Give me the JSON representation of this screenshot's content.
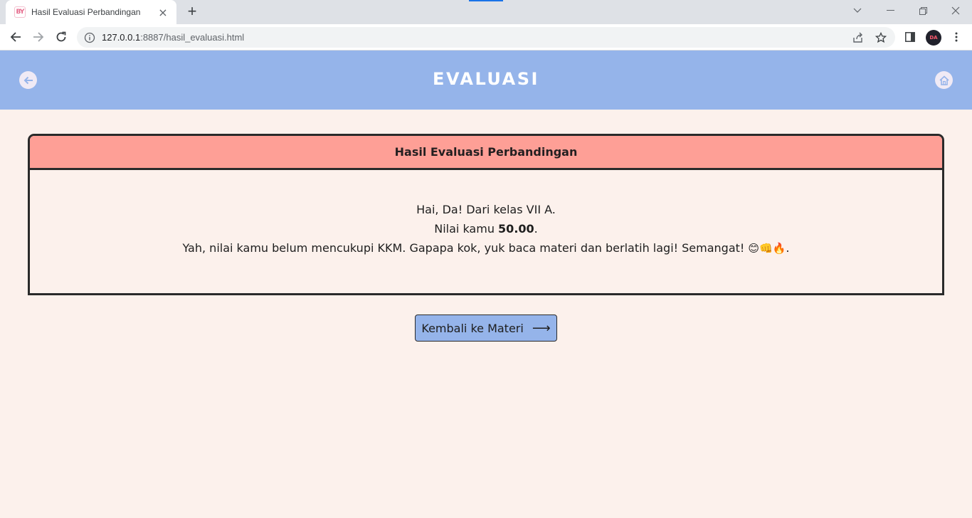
{
  "browser": {
    "tab_title": "Hasil Evaluasi Perbandingan",
    "favicon_text": "BY",
    "url_host": "127.0.0.1",
    "url_rest": ":8887/hasil_evaluasi.html",
    "profile_initials": "DA"
  },
  "header": {
    "title": "EVALUASI"
  },
  "card": {
    "title": "Hasil Evaluasi Perbandingan",
    "greeting": "Hai, Da! Dari kelas VII A.",
    "score_prefix": "Nilai kamu ",
    "score_value": "50.00",
    "score_suffix": ".",
    "message": "Yah, nilai kamu belum mencukupi KKM. Gapapa kok, yuk baca materi dan berlatih lagi! Semangat! ",
    "emojis": "😊👊🔥",
    "message_end": "."
  },
  "back_button": {
    "label": "Kembali ke Materi",
    "arrow": "⟶"
  },
  "colors": {
    "header_bg": "#95b4ea",
    "page_bg": "#fcf1ec",
    "card_head_bg": "#fe9f96",
    "border": "#2a2a2a"
  },
  "icons": [
    "arrow-left-icon",
    "home-icon",
    "info-icon",
    "share-icon",
    "star-icon",
    "sidepanel-icon",
    "menu-dots-icon"
  ]
}
